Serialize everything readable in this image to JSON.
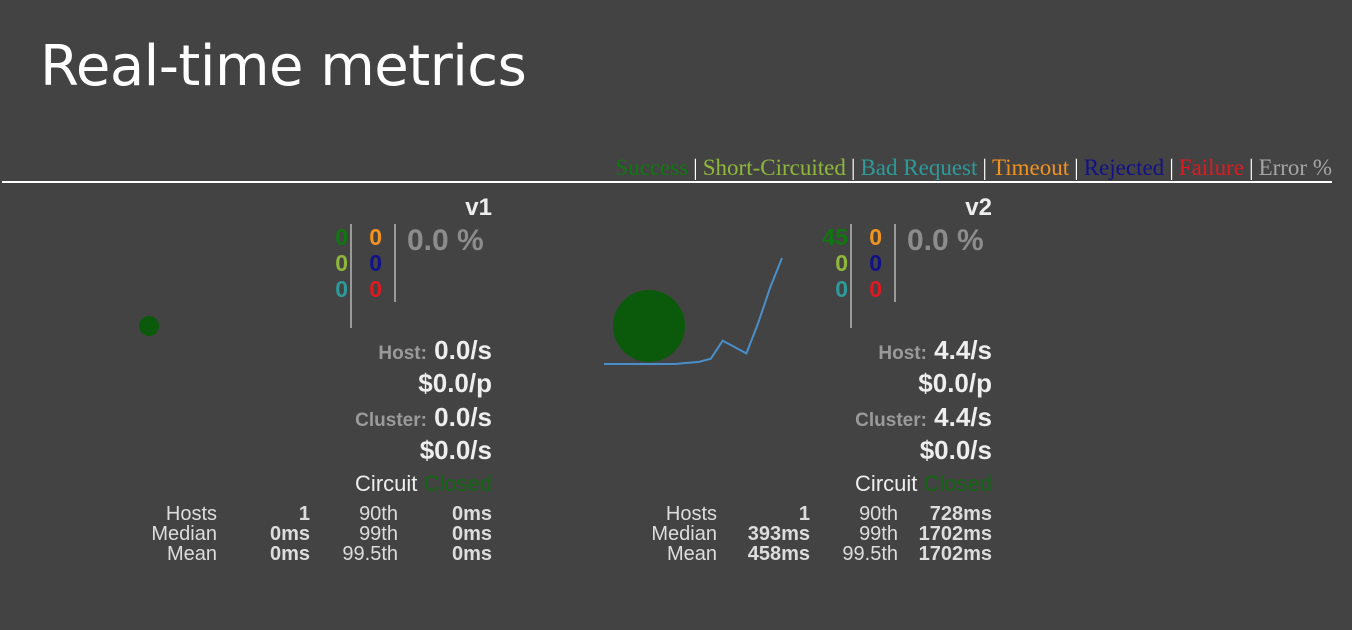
{
  "page": {
    "title": "Real-time metrics"
  },
  "legend": {
    "items": [
      {
        "label": "Success",
        "color": "#117611"
      },
      {
        "label": "Short-Circuited",
        "color": "#8fb83a"
      },
      {
        "label": "Bad Request",
        "color": "#2e9a9a"
      },
      {
        "label": "Timeout",
        "color": "#f3931f"
      },
      {
        "label": "Rejected",
        "color": "#111188"
      },
      {
        "label": "Failure",
        "color": "#dd1a22"
      },
      {
        "label": "Error %",
        "color": "#a5a5a5"
      }
    ],
    "separator": "|"
  },
  "cards": [
    {
      "name": "v1",
      "counts": {
        "success": "0",
        "short_circuited": "0",
        "bad_request": "0",
        "timeout": "0",
        "rejected": "0",
        "failure": "0"
      },
      "error_percent": "0.0 %",
      "host_label": "Host:",
      "host_rate": "0.0/s",
      "host_cost": "$0.0/p",
      "cluster_label": "Cluster:",
      "cluster_rate": "0.0/s",
      "cluster_cost": "$0.0/s",
      "circuit_label": "Circuit",
      "circuit_status": "Closed",
      "stats": {
        "hosts_label": "Hosts",
        "hosts": "1",
        "median_label": "Median",
        "median": "0ms",
        "mean_label": "Mean",
        "mean": "0ms",
        "p90_label": "90th",
        "p90": "0ms",
        "p99_label": "99th",
        "p99": "0ms",
        "p995_label": "99.5th",
        "p995": "0ms"
      },
      "bubble": {
        "color": "#0b5a0b",
        "level": "small"
      },
      "sparkline": []
    },
    {
      "name": "v2",
      "counts": {
        "success": "45",
        "short_circuited": "0",
        "bad_request": "0",
        "timeout": "0",
        "rejected": "0",
        "failure": "0"
      },
      "error_percent": "0.0 %",
      "host_label": "Host:",
      "host_rate": "4.4/s",
      "host_cost": "$0.0/p",
      "cluster_label": "Cluster:",
      "cluster_rate": "4.4/s",
      "cluster_cost": "$0.0/s",
      "circuit_label": "Circuit",
      "circuit_status": "Closed",
      "stats": {
        "hosts_label": "Hosts",
        "hosts": "1",
        "median_label": "Median",
        "median": "393ms",
        "mean_label": "Mean",
        "mean": "458ms",
        "p90_label": "90th",
        "p90": "728ms",
        "p99_label": "99th",
        "p99": "1702ms",
        "p995_label": "99.5th",
        "p995": "1702ms"
      },
      "bubble": {
        "color": "#0b5a0b",
        "level": "large"
      },
      "sparkline": [
        0,
        0,
        0,
        0,
        0,
        0,
        0,
        0.01,
        0.02,
        0.05,
        0.22,
        0.16,
        0.1,
        0.39,
        0.72,
        1.0
      ]
    }
  ]
}
